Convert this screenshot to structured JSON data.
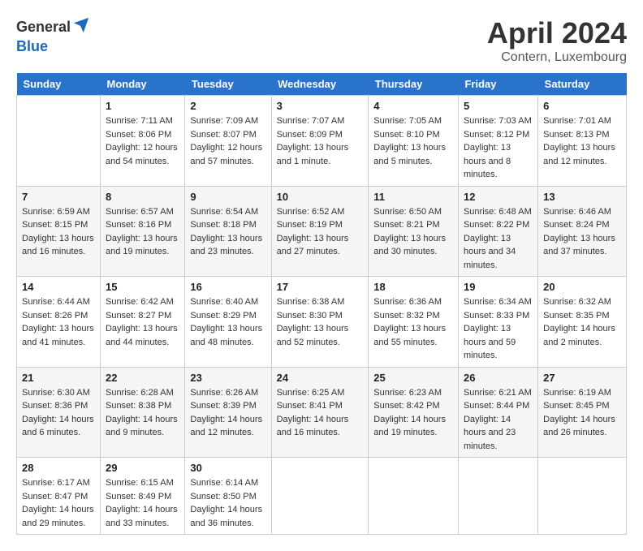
{
  "header": {
    "logo_line1": "General",
    "logo_line2": "Blue",
    "title": "April 2024",
    "subtitle": "Contern, Luxembourg"
  },
  "columns": [
    "Sunday",
    "Monday",
    "Tuesday",
    "Wednesday",
    "Thursday",
    "Friday",
    "Saturday"
  ],
  "weeks": [
    [
      {
        "day": "",
        "sunrise": "",
        "sunset": "",
        "daylight": ""
      },
      {
        "day": "1",
        "sunrise": "Sunrise: 7:11 AM",
        "sunset": "Sunset: 8:06 PM",
        "daylight": "Daylight: 12 hours and 54 minutes."
      },
      {
        "day": "2",
        "sunrise": "Sunrise: 7:09 AM",
        "sunset": "Sunset: 8:07 PM",
        "daylight": "Daylight: 12 hours and 57 minutes."
      },
      {
        "day": "3",
        "sunrise": "Sunrise: 7:07 AM",
        "sunset": "Sunset: 8:09 PM",
        "daylight": "Daylight: 13 hours and 1 minute."
      },
      {
        "day": "4",
        "sunrise": "Sunrise: 7:05 AM",
        "sunset": "Sunset: 8:10 PM",
        "daylight": "Daylight: 13 hours and 5 minutes."
      },
      {
        "day": "5",
        "sunrise": "Sunrise: 7:03 AM",
        "sunset": "Sunset: 8:12 PM",
        "daylight": "Daylight: 13 hours and 8 minutes."
      },
      {
        "day": "6",
        "sunrise": "Sunrise: 7:01 AM",
        "sunset": "Sunset: 8:13 PM",
        "daylight": "Daylight: 13 hours and 12 minutes."
      }
    ],
    [
      {
        "day": "7",
        "sunrise": "Sunrise: 6:59 AM",
        "sunset": "Sunset: 8:15 PM",
        "daylight": "Daylight: 13 hours and 16 minutes."
      },
      {
        "day": "8",
        "sunrise": "Sunrise: 6:57 AM",
        "sunset": "Sunset: 8:16 PM",
        "daylight": "Daylight: 13 hours and 19 minutes."
      },
      {
        "day": "9",
        "sunrise": "Sunrise: 6:54 AM",
        "sunset": "Sunset: 8:18 PM",
        "daylight": "Daylight: 13 hours and 23 minutes."
      },
      {
        "day": "10",
        "sunrise": "Sunrise: 6:52 AM",
        "sunset": "Sunset: 8:19 PM",
        "daylight": "Daylight: 13 hours and 27 minutes."
      },
      {
        "day": "11",
        "sunrise": "Sunrise: 6:50 AM",
        "sunset": "Sunset: 8:21 PM",
        "daylight": "Daylight: 13 hours and 30 minutes."
      },
      {
        "day": "12",
        "sunrise": "Sunrise: 6:48 AM",
        "sunset": "Sunset: 8:22 PM",
        "daylight": "Daylight: 13 hours and 34 minutes."
      },
      {
        "day": "13",
        "sunrise": "Sunrise: 6:46 AM",
        "sunset": "Sunset: 8:24 PM",
        "daylight": "Daylight: 13 hours and 37 minutes."
      }
    ],
    [
      {
        "day": "14",
        "sunrise": "Sunrise: 6:44 AM",
        "sunset": "Sunset: 8:26 PM",
        "daylight": "Daylight: 13 hours and 41 minutes."
      },
      {
        "day": "15",
        "sunrise": "Sunrise: 6:42 AM",
        "sunset": "Sunset: 8:27 PM",
        "daylight": "Daylight: 13 hours and 44 minutes."
      },
      {
        "day": "16",
        "sunrise": "Sunrise: 6:40 AM",
        "sunset": "Sunset: 8:29 PM",
        "daylight": "Daylight: 13 hours and 48 minutes."
      },
      {
        "day": "17",
        "sunrise": "Sunrise: 6:38 AM",
        "sunset": "Sunset: 8:30 PM",
        "daylight": "Daylight: 13 hours and 52 minutes."
      },
      {
        "day": "18",
        "sunrise": "Sunrise: 6:36 AM",
        "sunset": "Sunset: 8:32 PM",
        "daylight": "Daylight: 13 hours and 55 minutes."
      },
      {
        "day": "19",
        "sunrise": "Sunrise: 6:34 AM",
        "sunset": "Sunset: 8:33 PM",
        "daylight": "Daylight: 13 hours and 59 minutes."
      },
      {
        "day": "20",
        "sunrise": "Sunrise: 6:32 AM",
        "sunset": "Sunset: 8:35 PM",
        "daylight": "Daylight: 14 hours and 2 minutes."
      }
    ],
    [
      {
        "day": "21",
        "sunrise": "Sunrise: 6:30 AM",
        "sunset": "Sunset: 8:36 PM",
        "daylight": "Daylight: 14 hours and 6 minutes."
      },
      {
        "day": "22",
        "sunrise": "Sunrise: 6:28 AM",
        "sunset": "Sunset: 8:38 PM",
        "daylight": "Daylight: 14 hours and 9 minutes."
      },
      {
        "day": "23",
        "sunrise": "Sunrise: 6:26 AM",
        "sunset": "Sunset: 8:39 PM",
        "daylight": "Daylight: 14 hours and 12 minutes."
      },
      {
        "day": "24",
        "sunrise": "Sunrise: 6:25 AM",
        "sunset": "Sunset: 8:41 PM",
        "daylight": "Daylight: 14 hours and 16 minutes."
      },
      {
        "day": "25",
        "sunrise": "Sunrise: 6:23 AM",
        "sunset": "Sunset: 8:42 PM",
        "daylight": "Daylight: 14 hours and 19 minutes."
      },
      {
        "day": "26",
        "sunrise": "Sunrise: 6:21 AM",
        "sunset": "Sunset: 8:44 PM",
        "daylight": "Daylight: 14 hours and 23 minutes."
      },
      {
        "day": "27",
        "sunrise": "Sunrise: 6:19 AM",
        "sunset": "Sunset: 8:45 PM",
        "daylight": "Daylight: 14 hours and 26 minutes."
      }
    ],
    [
      {
        "day": "28",
        "sunrise": "Sunrise: 6:17 AM",
        "sunset": "Sunset: 8:47 PM",
        "daylight": "Daylight: 14 hours and 29 minutes."
      },
      {
        "day": "29",
        "sunrise": "Sunrise: 6:15 AM",
        "sunset": "Sunset: 8:49 PM",
        "daylight": "Daylight: 14 hours and 33 minutes."
      },
      {
        "day": "30",
        "sunrise": "Sunrise: 6:14 AM",
        "sunset": "Sunset: 8:50 PM",
        "daylight": "Daylight: 14 hours and 36 minutes."
      },
      {
        "day": "",
        "sunrise": "",
        "sunset": "",
        "daylight": ""
      },
      {
        "day": "",
        "sunrise": "",
        "sunset": "",
        "daylight": ""
      },
      {
        "day": "",
        "sunrise": "",
        "sunset": "",
        "daylight": ""
      },
      {
        "day": "",
        "sunrise": "",
        "sunset": "",
        "daylight": ""
      }
    ]
  ]
}
